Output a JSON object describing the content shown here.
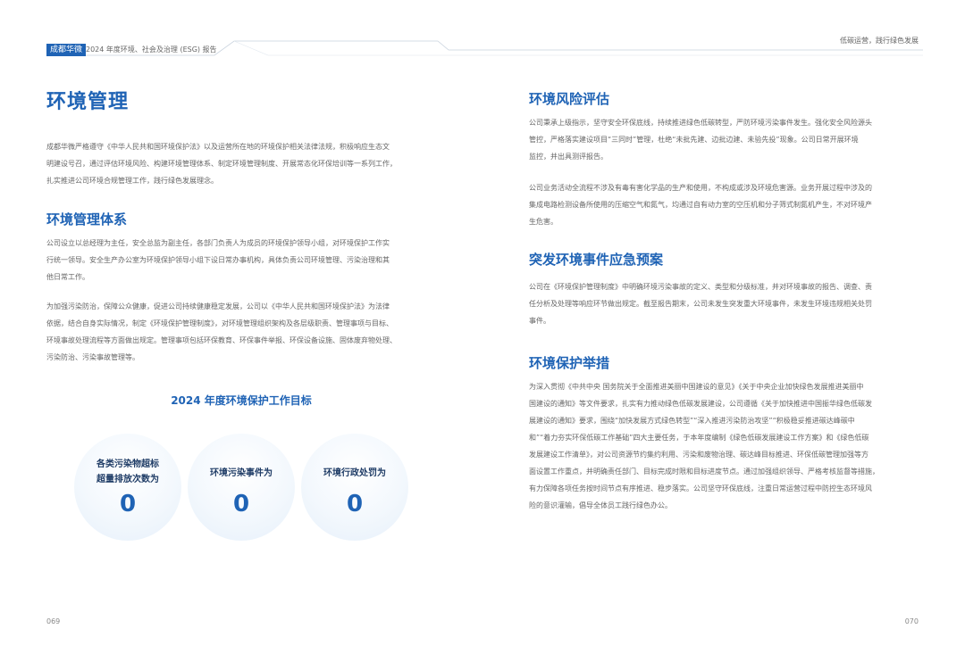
{
  "header": {
    "badge": "成都华微",
    "report_title": "2024 年度环境、社会及治理 (ESG) 报告",
    "right_title": "低碳运营，践行绿色发展"
  },
  "left": {
    "title": "环境管理",
    "intro": [
      "成都华微严格遵守《中华人民共和国环境保护法》以及运营所在地的环境保护相关法律法规，积极响应生态文",
      "明建设号召，通过评估环境风险、构建环境管理体系、制定环境管理制度、开展常态化环保培训等一系列工作，",
      "扎实推进公司环境合规管理工作，践行绿色发展理念。"
    ],
    "system_title": "环境管理体系",
    "system_p1": [
      "公司设立以总经理为主任，安全总监为副主任，各部门负责人为成员的环境保护领导小组，对环境保护工作实",
      "行统一领导。安全生产办公室为环境保护领导小组下设日常办事机构，具体负责公司环境管理、污染治理和其",
      "他日常工作。"
    ],
    "system_p2": [
      "为加强污染防治，保障公众健康，促进公司持续健康稳定发展，公司以《中华人民共和国环境保护法》为法律",
      "依据，结合自身实际情况，制定《环境保护管理制度》，对环境管理组织架构及各层级职责、管理事项与目标、",
      "环境事故处理流程等方面做出规定。管理事项包括环保教育、环保事件举报、环保设备设施、固体废弃物处理、",
      "污染防治、污染事故管理等。"
    ],
    "targets_title": "2024 年度环境保护工作目标",
    "targets": [
      {
        "label_lines": [
          "各类污染物超标",
          "超量排放次数为"
        ],
        "value": "0"
      },
      {
        "label_lines": [
          "环境污染事件为"
        ],
        "value": "0"
      },
      {
        "label_lines": [
          "环境行政处罚为"
        ],
        "value": "0"
      }
    ],
    "page_number": "069"
  },
  "right": {
    "risk_title": "环境风险评估",
    "risk_p1": [
      "公司秉承上级指示，坚守安全环保底线，持续推进绿色低碳转型，严防环境污染事件发生。强化安全风险源头",
      "管控，严格落实建设项目“三同时”管理，杜绝“未批先建、边批边建、未验先投”现象。公司日常开展环境",
      "监控，并出具测评报告。"
    ],
    "risk_p2": [
      "公司业务活动全流程不涉及有毒有害化学品的生产和使用，不构成或涉及环境危害源。业务开展过程中涉及的",
      "集成电路检测设备所使用的压缩空气和氮气，均通过自有动力室的空压机和分子筛式制氮机产生，不对环境产",
      "生危害。"
    ],
    "emergency_title": "突发环境事件应急预案",
    "emergency_p": [
      "公司在《环境保护管理制度》中明确环境污染事故的定义、类型和分级标准，并对环境事故的报告、调查、责",
      "任分析及处理等响应环节做出规定。截至报告期末，公司未发生突发重大环境事件，未发生环境违规相关处罚",
      "事件。"
    ],
    "measures_title": "环境保护举措",
    "measures_p": [
      "为深入贯彻《中共中央 国务院关于全面推进美丽中国建设的意见》《关于中央企业加快绿色发展推进美丽中",
      "国建设的通知》等文件要求，扎实有力推动绿色低碳发展建设，公司遵循《关于加快推进中国振华绿色低碳发",
      "展建设的通知》要求，围绕“加快发展方式绿色转型”“深入推进污染防治攻坚”“积极稳妥推进碳达峰碳中",
      "和”“着力夯实环保低碳工作基础”四大主要任务，于本年度编制《绿色低碳发展建设工作方案》和《绿色低碳",
      "发展建设工作清单》，对公司资源节约集约利用、污染和废物治理、碳达峰目标推进、环保低碳管理加强等方",
      "面设置工作重点，并明确责任部门、目标完成时限和目标进度节点。通过加强组织领导、严格考核监督等措施，",
      "有力保障各项任务按时间节点有序推进、稳步落实。公司坚守环保底线，注重日常运营过程中防控生态环境风",
      "险的意识灌输，倡导全体员工践行绿色办公。"
    ],
    "page_number": "070"
  },
  "colors": {
    "accent": "#1f63b5",
    "text": "#666666"
  }
}
